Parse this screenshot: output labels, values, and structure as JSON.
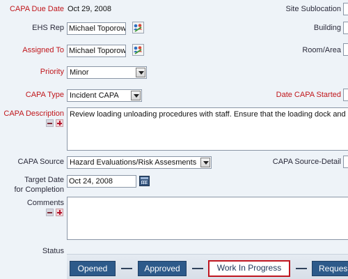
{
  "fields": {
    "capa_due_date": {
      "label": "CAPA Due Date",
      "value": "Oct 29, 2008"
    },
    "site_sublocation": {
      "label": "Site Sublocation"
    },
    "ehs_rep": {
      "label": "EHS Rep",
      "value": "Michael Toporow"
    },
    "building": {
      "label": "Building"
    },
    "assigned_to": {
      "label": "Assigned To",
      "value": "Michael Toporow"
    },
    "room_area": {
      "label": "Room/Area"
    },
    "priority": {
      "label": "Priority",
      "value": "Minor"
    },
    "capa_type": {
      "label": "CAPA Type",
      "value": "Incident CAPA"
    },
    "date_capa_started": {
      "label": "Date CAPA Started"
    },
    "capa_description": {
      "label": "CAPA Description",
      "value": "Review loading unloading procedures with staff. Ensure that the loading dock and"
    },
    "capa_source": {
      "label": "CAPA Source",
      "value": "Hazard Evaluations/Risk Assesments"
    },
    "capa_source_detail": {
      "label": "CAPA Source-Detail"
    },
    "target_date": {
      "label_line1": "Target Date",
      "label_line2": "for Completion",
      "value": "Oct 24, 2008"
    },
    "comments": {
      "label": "Comments",
      "value": ""
    },
    "status": {
      "label": "Status"
    }
  },
  "workflow": {
    "stages": [
      "Opened",
      "Approved",
      "Work In Progress",
      "Reques"
    ],
    "current_stage": "Work In Progress"
  },
  "colors": {
    "required_label": "#c0161b",
    "stage_fill": "#2d5a8a",
    "current_stage_border": "#c01620"
  },
  "icons": {
    "people_picker": "people-picker-icon",
    "calendar": "calendar-icon",
    "collapse": "collapse-minus-icon",
    "expand": "expand-plus-icon"
  }
}
